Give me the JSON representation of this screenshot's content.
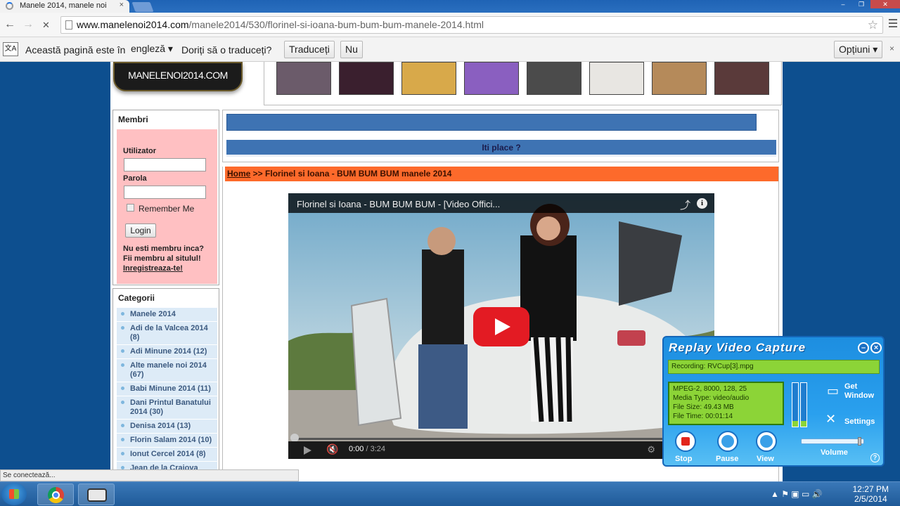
{
  "browser": {
    "tab_title": "Manele 2014, manele noi",
    "tab_close": "×",
    "url_host": "www.manelenoi2014.com",
    "url_path": "/manele2014/530/florinel-si-ioana-bum-bum-bum-manele-2014.html",
    "back_glyph": "←",
    "forward_glyph": "→",
    "stop_glyph": "✕",
    "star_glyph": "☆",
    "window_buttons": [
      "–",
      "❐",
      "✕"
    ]
  },
  "translate_bar": {
    "icon_text": "文A",
    "text1": "Această pagină este în",
    "language": "engleză",
    "text2": "Doriți să o traduceți?",
    "translate_button": "Traduceți",
    "no_button": "Nu",
    "options_button": "Opțiuni",
    "close": "×"
  },
  "site": {
    "logo_text": "MANELENOI2014.COM",
    "like_text": "Iti place ?",
    "breadcrumb_home": "Home",
    "breadcrumb_rest": " >> Florinel si Ioana - BUM BUM BUM manele 2014",
    "thumb_colors": [
      "#6b5b6a",
      "#3a1f2e",
      "#d8a94a",
      "#8a5fc0",
      "#4b4b4b",
      "#e8e6e2",
      "#b58a5a",
      "#5a3a3a"
    ]
  },
  "members": {
    "title": "Membri",
    "user_label": "Utilizator",
    "pass_label": "Parola",
    "remember": "Remember Me",
    "login_button": "Login",
    "reg_line1": "Nu esti membru inca?",
    "reg_line2": "Fii membru al situlul!",
    "reg_link": "Inregistreaza-te!"
  },
  "categories": {
    "title": "Categorii",
    "items": [
      "Manele 2014",
      "Adi de la Valcea 2014 (8)",
      "Adi Minune 2014 (12)",
      "Alte manele noi 2014 (67)",
      "Babi Minune 2014 (11)",
      "Dani Printul Banatului 2014 (30)",
      "Denisa 2014 (13)",
      "Florin Salam 2014 (10)",
      "Ionut Cercel 2014 (8)",
      "Jean de la Craiova"
    ]
  },
  "video": {
    "title": "Florinel si Ioana - BUM BUM BUM - [Video Offici...",
    "share_glyph": "⤴",
    "info_glyph": "i",
    "volume_glyph": "🔇",
    "time_current": "0:00",
    "time_sep": " / ",
    "time_duration": "3:24",
    "settings_glyph": "⚙",
    "progress": 0
  },
  "status_bar": "Se conectează...",
  "replay": {
    "title": "Replay Video Capture",
    "min": "–",
    "close": "×",
    "recording": "Recording: RVCup[3].mpg",
    "info_lines": [
      "MPEG-2, 8000, 128, 25",
      "Media Type: video/audio",
      "File Size: 49.43 MB",
      "File Time: 00:01:14"
    ],
    "get_window_1": "Get",
    "get_window_2": "Window",
    "settings": "Settings",
    "stop": "Stop",
    "pause": "Pause",
    "view": "View",
    "volume": "Volume",
    "help": "?",
    "volume_level": 0.95
  },
  "taskbar": {
    "tray_icons": "▲  ⚑  ▣  ▭  🔊",
    "time": "12:27 PM",
    "date": "2/5/2014"
  }
}
